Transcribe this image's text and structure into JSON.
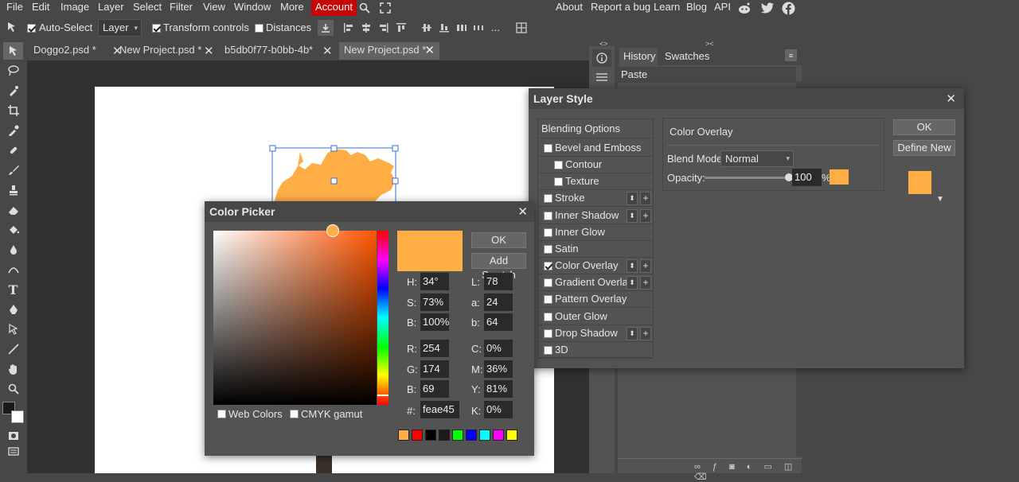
{
  "menu": {
    "items": [
      "File",
      "Edit",
      "Image",
      "Layer",
      "Select",
      "Filter",
      "View",
      "Window",
      "More"
    ],
    "account": "Account",
    "right": [
      "About",
      "Report a bug",
      "Learn",
      "Blog",
      "API"
    ]
  },
  "options": {
    "auto_select": "Auto-Select",
    "layer_select": "Layer",
    "transform_controls": "Transform controls",
    "distances": "Distances",
    "more": "..."
  },
  "tabs": [
    {
      "label": "Doggo2.psd *"
    },
    {
      "label": "New Project.psd *"
    },
    {
      "label": "b5db0f77-b0bb-4b"
    },
    {
      "label": "New Project.psd *"
    }
  ],
  "tab3_suffix": "*",
  "panel": {
    "tab_history": "History",
    "tab_swatches": "Swatches",
    "history_item": "Paste"
  },
  "color_picker": {
    "title": "Color Picker",
    "ok": "OK",
    "add_swatch": "Add Swatch",
    "color": "#feae45",
    "hue_fraction": 0.0556,
    "sat_fraction": 0.73,
    "bri_fraction": 1.0,
    "fields": {
      "h_label": "H:",
      "h": "34°",
      "s_label": "S:",
      "s": "73%",
      "b_label": "B:",
      "b": "100%",
      "r_label": "R:",
      "r": "254",
      "g_label": "G:",
      "g": "174",
      "b2_label": "B:",
      "b2": "69",
      "hex_label": "#:",
      "hex": "feae45",
      "l_label": "L:",
      "l": "78",
      "a_label": "a:",
      "a": "24",
      "lb_label": "b:",
      "lb": "64",
      "c_label": "C:",
      "c": "0%",
      "m_label": "M:",
      "m": "36%",
      "y_label": "Y:",
      "y": "81%",
      "k_label": "K:",
      "k": "0%"
    },
    "web_colors": "Web Colors",
    "cmyk_gamut": "CMYK gamut",
    "swatches": [
      "#feae45",
      "#ff0000",
      "#000000",
      "#1a1a1a",
      "#00ff00",
      "#0000ff",
      "#00ffff",
      "#ff00ff",
      "#ffff00"
    ]
  },
  "layer_style": {
    "title": "Layer Style",
    "ok": "OK",
    "define_new": "Define New",
    "blending_options": "Blending Options",
    "rows": [
      {
        "label": "Bevel and Emboss",
        "checked": false,
        "indent": false,
        "arrows": false
      },
      {
        "label": "Contour",
        "checked": false,
        "indent": true,
        "arrows": false
      },
      {
        "label": "Texture",
        "checked": false,
        "indent": true,
        "arrows": false
      },
      {
        "label": "Stroke",
        "checked": false,
        "indent": false,
        "arrows": true
      },
      {
        "label": "Inner Shadow",
        "checked": false,
        "indent": false,
        "arrows": true
      },
      {
        "label": "Inner Glow",
        "checked": false,
        "indent": false,
        "arrows": false
      },
      {
        "label": "Satin",
        "checked": false,
        "indent": false,
        "arrows": false
      },
      {
        "label": "Color Overlay",
        "checked": true,
        "indent": false,
        "arrows": true
      },
      {
        "label": "Gradient Overlay",
        "checked": false,
        "indent": false,
        "arrows": true
      },
      {
        "label": "Pattern Overlay",
        "checked": false,
        "indent": false,
        "arrows": false
      },
      {
        "label": "Outer Glow",
        "checked": false,
        "indent": false,
        "arrows": false
      },
      {
        "label": "Drop Shadow",
        "checked": false,
        "indent": false,
        "arrows": true
      },
      {
        "label": "3D",
        "checked": false,
        "indent": false,
        "arrows": false
      }
    ],
    "section_title": "Color Overlay",
    "blend_mode_label": "Blend Mode:",
    "blend_mode": "Normal",
    "opacity_label": "Opacity:",
    "opacity": "100",
    "opacity_unit": "%",
    "overlay_color": "#feae45"
  }
}
